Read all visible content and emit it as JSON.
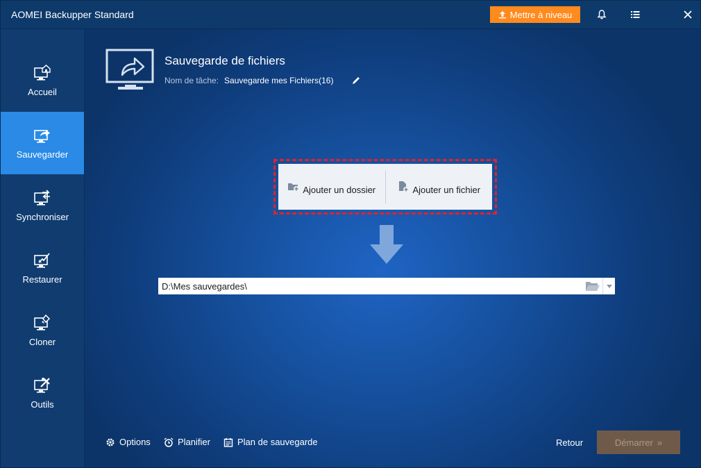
{
  "window": {
    "title": "AOMEI Backupper Standard"
  },
  "titlebar": {
    "upgrade_label": "Mettre à niveau",
    "icons": [
      "bell-icon",
      "menu-icon",
      "close-icon"
    ]
  },
  "sidebar": {
    "items": [
      {
        "label": "Accueil",
        "icon": "home-icon",
        "active": false
      },
      {
        "label": "Sauvegarder",
        "icon": "backup-icon",
        "active": true
      },
      {
        "label": "Synchroniser",
        "icon": "sync-icon",
        "active": false
      },
      {
        "label": "Restaurer",
        "icon": "restore-icon",
        "active": false
      },
      {
        "label": "Cloner",
        "icon": "clone-icon",
        "active": false
      },
      {
        "label": "Outils",
        "icon": "tools-icon",
        "active": false
      }
    ]
  },
  "main": {
    "title": "Sauvegarde de fichiers",
    "task_label": "Nom de tâche:",
    "task_value": "Sauvegarde mes Fichiers(16)",
    "add_folder_label": "Ajouter un dossier",
    "add_file_label": "Ajouter un fichier",
    "destination_value": "D:\\Mes sauvegardes\\"
  },
  "footer": {
    "options_label": "Options",
    "schedule_label": "Planifier",
    "plan_label": "Plan de sauvegarde",
    "back_label": "Retour",
    "start_label": "Démarrer"
  },
  "colors": {
    "accent": "#2a8ae6",
    "upgrade": "#ff8a1e",
    "highlight_border": "#e0232b",
    "start_disabled": "#6f5a49"
  }
}
